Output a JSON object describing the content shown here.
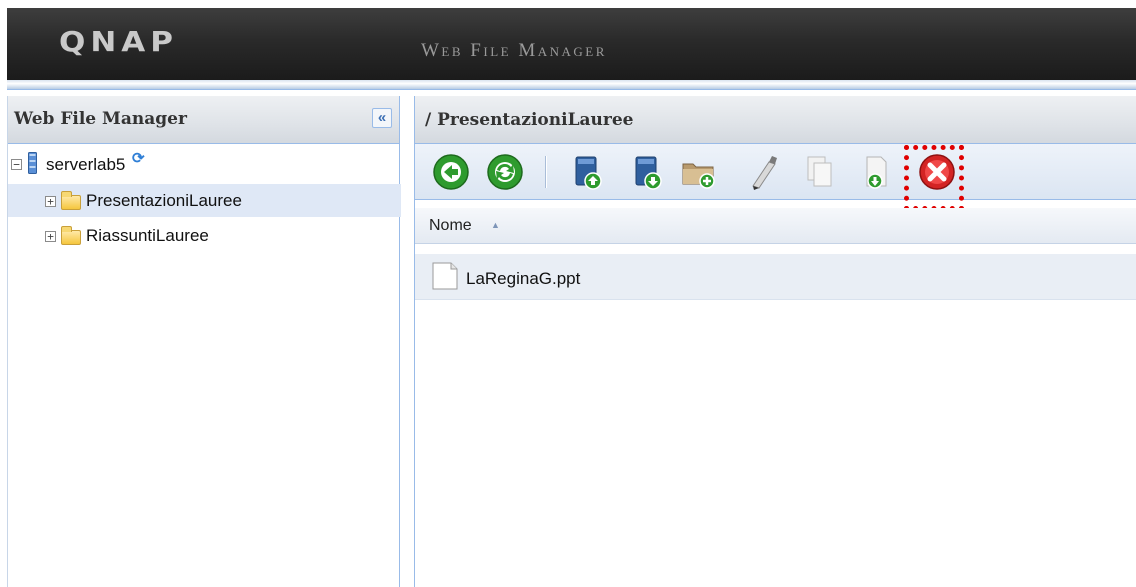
{
  "header": {
    "logo": "QNAP",
    "app_title": "Web File Manager"
  },
  "sidebar": {
    "title": "Web File Manager",
    "collapse_glyph": "«",
    "tree": {
      "root": {
        "label": "serverlab5",
        "toggle": "−"
      },
      "items": [
        {
          "label": "PresentazioniLauree",
          "toggle": "+",
          "selected": true
        },
        {
          "label": "RiassuntiLauree",
          "toggle": "+",
          "selected": false
        }
      ]
    }
  },
  "main": {
    "path": "/ PresentazioniLauree",
    "toolbar": {
      "buttons": [
        {
          "name": "back-icon"
        },
        {
          "name": "refresh-icon"
        },
        {
          "name": "upload-icon"
        },
        {
          "name": "download-icon"
        },
        {
          "name": "new-folder-icon"
        },
        {
          "name": "rename-icon"
        },
        {
          "name": "copy-icon"
        },
        {
          "name": "move-icon"
        },
        {
          "name": "delete-icon"
        }
      ]
    },
    "columns": {
      "name": "Nome",
      "sort_glyph": "▲"
    },
    "files": [
      {
        "name": "LaReginaG.ppt",
        "icon": "document-icon"
      }
    ]
  },
  "colors": {
    "accent_border": "#99bbe8",
    "selected_row": "#dfe8f6",
    "highlight": "#e00000",
    "banner": "#2a2a2a"
  }
}
